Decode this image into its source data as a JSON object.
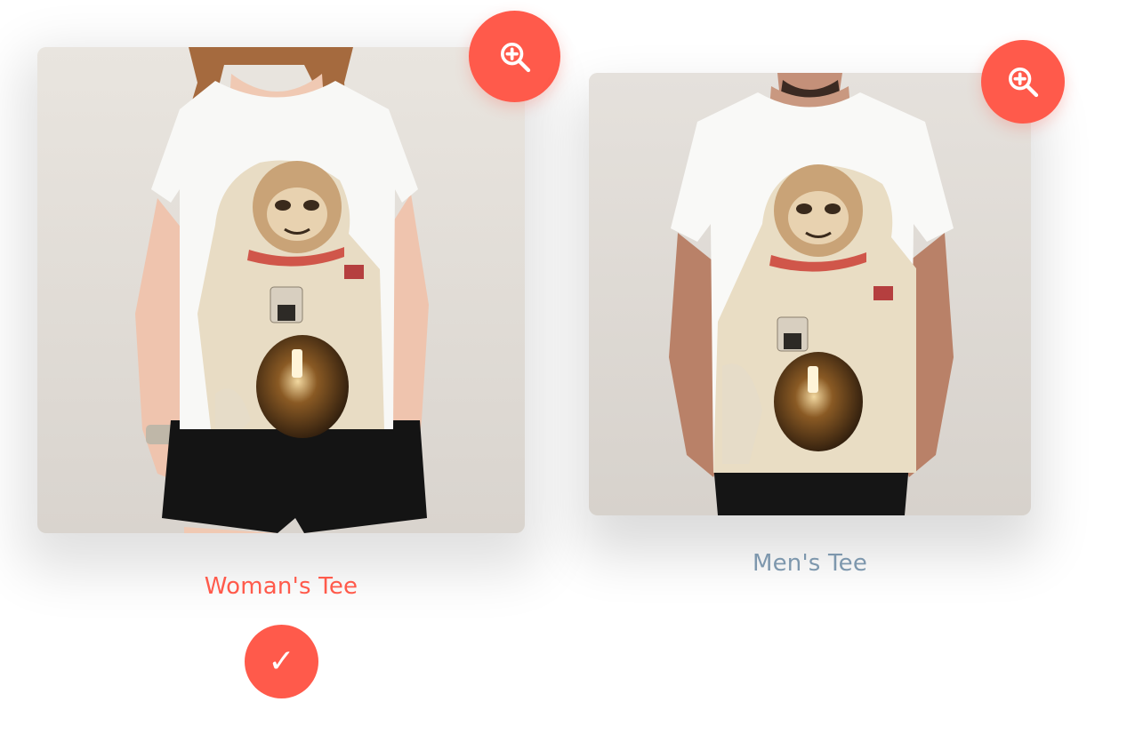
{
  "options": [
    {
      "label": "Woman's Tee",
      "selected": true,
      "zoom_icon": "zoom-in-icon",
      "label_color": "#ff5a4b"
    },
    {
      "label": "Men's Tee",
      "selected": false,
      "zoom_icon": "zoom-in-icon",
      "label_color": "#7d97ad"
    }
  ],
  "selected_indicator": {
    "icon": "checkmark-icon",
    "glyph": "✓"
  },
  "colors": {
    "accent": "#ff5a4b",
    "inactive_label": "#7d97ad",
    "background": "#ffffff"
  }
}
